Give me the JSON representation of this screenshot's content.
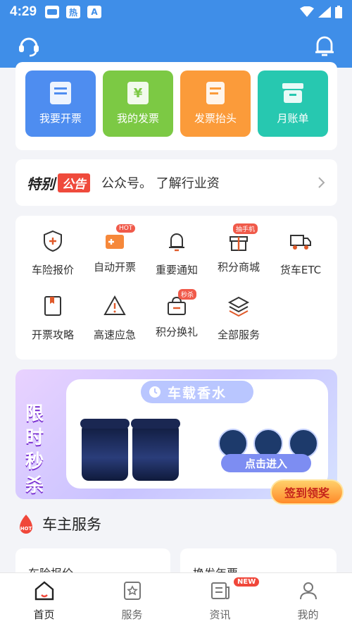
{
  "status": {
    "time": "4:29",
    "icon1": "热",
    "icon2": "A"
  },
  "header": {
    "left_icon": "customer-service-icon",
    "right_icon": "bell-icon"
  },
  "quick_actions": [
    {
      "label": "我要开票",
      "color": "#4e8df0"
    },
    {
      "label": "我的发票",
      "color": "#7cc944"
    },
    {
      "label": "发票抬头",
      "color": "#fb9b3a"
    },
    {
      "label": "月账单",
      "color": "#27c8b0"
    }
  ],
  "notice": {
    "title_a": "特别",
    "title_b": "公告",
    "scroll_text": "公众号。          了解行业资"
  },
  "services": [
    {
      "label": "车险报价",
      "icon": "shield-plus-icon",
      "badge": ""
    },
    {
      "label": "自动开票",
      "icon": "ticket-icon",
      "badge": "HOT"
    },
    {
      "label": "重要通知",
      "icon": "bell-icon",
      "badge": ""
    },
    {
      "label": "积分商城",
      "icon": "gift-box-icon",
      "badge": "抽手机"
    },
    {
      "label": "货车ETC",
      "icon": "truck-icon",
      "badge": ""
    },
    {
      "label": "开票攻略",
      "icon": "book-icon",
      "badge": ""
    },
    {
      "label": "高速应急",
      "icon": "warning-icon",
      "badge": ""
    },
    {
      "label": "积分换礼",
      "icon": "basket-icon",
      "badge": "秒杀"
    },
    {
      "label": "全部服务",
      "icon": "layers-icon",
      "badge": ""
    }
  ],
  "banner": {
    "left_text": [
      "限",
      "时",
      "秒",
      "杀"
    ],
    "title": "车载香水",
    "cta": "点击进入",
    "signin": "签到领奖"
  },
  "section": {
    "title": "车主服务",
    "hot": "HOT",
    "card1": "车险报价",
    "card2": "换发年票"
  },
  "tabs": [
    {
      "label": "首页",
      "active": true
    },
    {
      "label": "服务",
      "active": false
    },
    {
      "label": "资讯",
      "active": false,
      "badge": "NEW"
    },
    {
      "label": "我的",
      "active": false
    }
  ]
}
